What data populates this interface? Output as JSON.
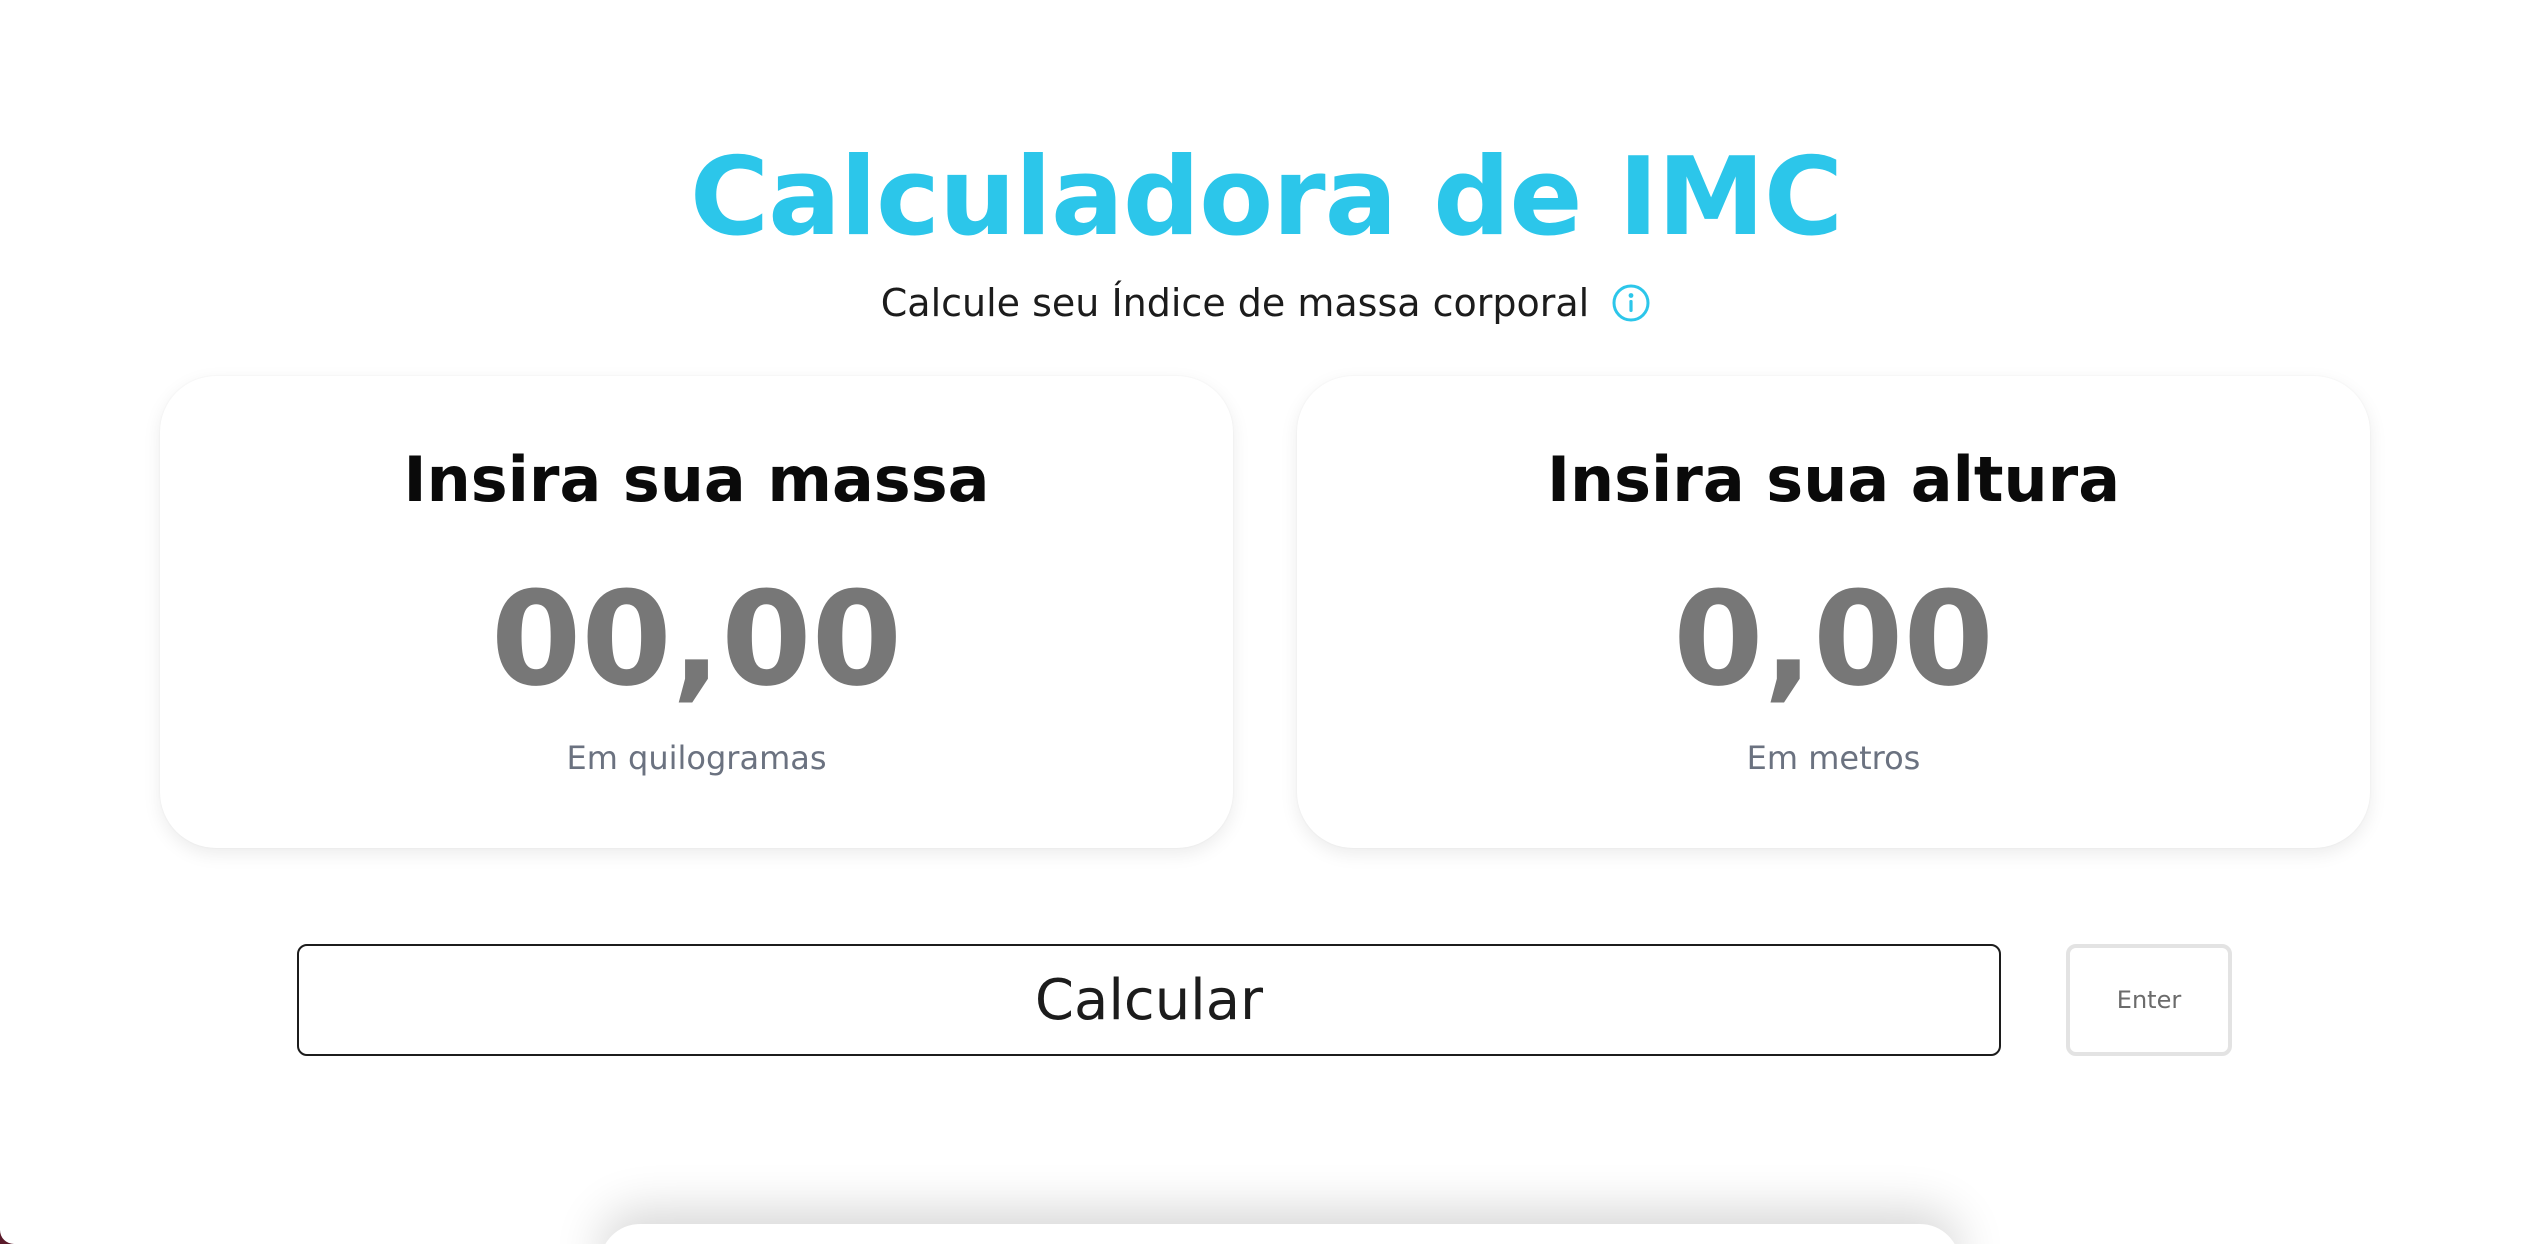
{
  "header": {
    "title": "Calculadora de IMC",
    "subtitle": "Calcule seu Índice de massa corporal",
    "info_icon": "info-circle-icon"
  },
  "mass_card": {
    "heading": "Insira sua massa",
    "value": "00,00",
    "unit": "Em quilogramas"
  },
  "height_card": {
    "heading": "Insira sua altura",
    "value": "0,00",
    "unit": "Em metros"
  },
  "actions": {
    "calculate_label": "Calcular",
    "enter_hint": "Enter"
  },
  "colors": {
    "accent": "#2cc6ea",
    "value_text": "#777777",
    "muted_text": "#6b7280",
    "heading_text": "#0a0a0a"
  }
}
